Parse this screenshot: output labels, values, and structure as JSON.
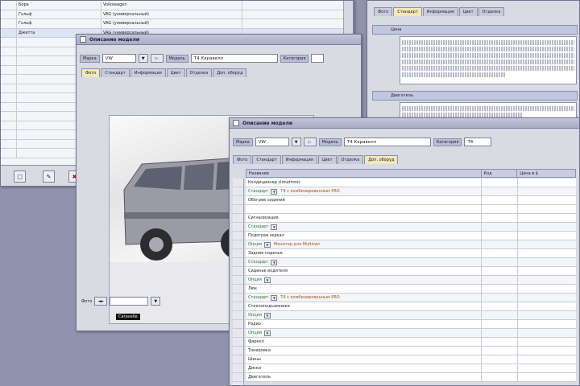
{
  "list_window": {
    "rows": [
      {
        "c2": "Бора",
        "c3": "Volkswagen"
      },
      {
        "c2": "Гольф",
        "c3": "VAG (универсальный)"
      },
      {
        "c2": "Гольф",
        "c3": "VAG (универсальный)"
      },
      {
        "c2": "Джетта",
        "c3": "VAG (универсальный)"
      },
      {
        "c2": "",
        "c3": ""
      },
      {
        "c2": "",
        "c3": ""
      },
      {
        "c2": "",
        "c3": ""
      },
      {
        "c2": "",
        "c3": ""
      },
      {
        "c2": "",
        "c3": ""
      },
      {
        "c2": "",
        "c3": ""
      },
      {
        "c2": "",
        "c3": ""
      },
      {
        "c2": "",
        "c3": ""
      },
      {
        "c2": "",
        "c3": ""
      },
      {
        "c2": "",
        "c3": ""
      },
      {
        "c2": "",
        "c3": ""
      },
      {
        "c2": "",
        "c3": ""
      },
      {
        "c2": "",
        "c3": ""
      }
    ]
  },
  "desc_window": {
    "tabs": [
      "Фото",
      "Стандарт",
      "Информация",
      "Цвет",
      "Отделка"
    ],
    "active_tab": 1,
    "header1": "Цена",
    "header2": "Двигатель"
  },
  "photo_window": {
    "title": "Описание модели",
    "mark_label": "Марка",
    "mark_value": "VW",
    "model_label": "Модель",
    "model_value": "T4 Каравелл",
    "cat_label": "Категория",
    "tabs": [
      "Фото",
      "Стандарт",
      "Информация",
      "Цвет",
      "Отделка",
      "Доп. оборуд"
    ],
    "active_tab": 0,
    "photo_caption": "Caravelle",
    "footer_label": "Фото"
  },
  "equip_window": {
    "title": "Описание модели",
    "mark_label": "Марка",
    "mark_value": "VW",
    "model_label": "Модель",
    "model_value": "T4 Каравелл",
    "cat_label": "Категория",
    "cat_value": "T4",
    "tabs": [
      "Фото",
      "Стандарт",
      "Информация",
      "Цвет",
      "Отделка",
      "Доп. оборуд"
    ],
    "active_tab": 5,
    "col_name": "Название",
    "col_code": "Код",
    "col_price": "Цена в $",
    "rows": [
      {
        "n": "Кондиционер climatronic",
        "k": "",
        "p": "",
        "g": false,
        "note": ""
      },
      {
        "n": "Стандарт",
        "k": "",
        "p": "",
        "g": true,
        "note": "Т4 с комбинированным PRO"
      },
      {
        "n": "Обогрев сидений",
        "k": "",
        "p": "",
        "g": false,
        "note": ""
      },
      {
        "n": "",
        "k": "",
        "p": "",
        "g": false,
        "note": ""
      },
      {
        "n": "Сигнализация",
        "k": "",
        "p": "",
        "g": false,
        "note": ""
      },
      {
        "n": "Стандарт",
        "k": "",
        "p": "",
        "g": true,
        "note": ""
      },
      {
        "n": "Подогрев зеркал",
        "k": "",
        "p": "",
        "g": false,
        "note": ""
      },
      {
        "n": "Опция",
        "k": "",
        "p": "",
        "g": true,
        "note": "Монитор для Multivan"
      },
      {
        "n": "Задние сиденья",
        "k": "",
        "p": "",
        "g": false,
        "note": ""
      },
      {
        "n": "Стандарт",
        "k": "",
        "p": "",
        "g": true,
        "note": ""
      },
      {
        "n": "Сиденье водителя",
        "k": "",
        "p": "",
        "g": false,
        "note": ""
      },
      {
        "n": "Опция",
        "k": "",
        "p": "",
        "g": true,
        "note": ""
      },
      {
        "n": "Люк",
        "k": "",
        "p": "",
        "g": false,
        "note": ""
      },
      {
        "n": "Стандарт",
        "k": "",
        "p": "",
        "g": true,
        "note": "Т4 с комбинированным PRO"
      },
      {
        "n": "Стеклоподъемники",
        "k": "",
        "p": "",
        "g": false,
        "note": ""
      },
      {
        "n": "Опция",
        "k": "",
        "p": "",
        "g": true,
        "note": ""
      },
      {
        "n": "Радио",
        "k": "",
        "p": "",
        "g": false,
        "note": ""
      },
      {
        "n": "Опция",
        "k": "",
        "p": "",
        "g": true,
        "note": ""
      },
      {
        "n": "Фаркоп",
        "k": "",
        "p": "",
        "g": false,
        "note": ""
      },
      {
        "n": "Тонировка",
        "k": "",
        "p": "",
        "g": false,
        "note": ""
      },
      {
        "n": "Шины",
        "k": "",
        "p": "",
        "g": false,
        "note": ""
      },
      {
        "n": "Диски",
        "k": "",
        "p": "",
        "g": false,
        "note": ""
      },
      {
        "n": "Двигатель",
        "k": "",
        "p": "",
        "g": false,
        "note": ""
      }
    ]
  },
  "colors": {
    "desktop": "#8f93ad",
    "tab_active": "#f3e7b6",
    "group_text": "#2a7a2a",
    "note_text": "#a5521f"
  }
}
